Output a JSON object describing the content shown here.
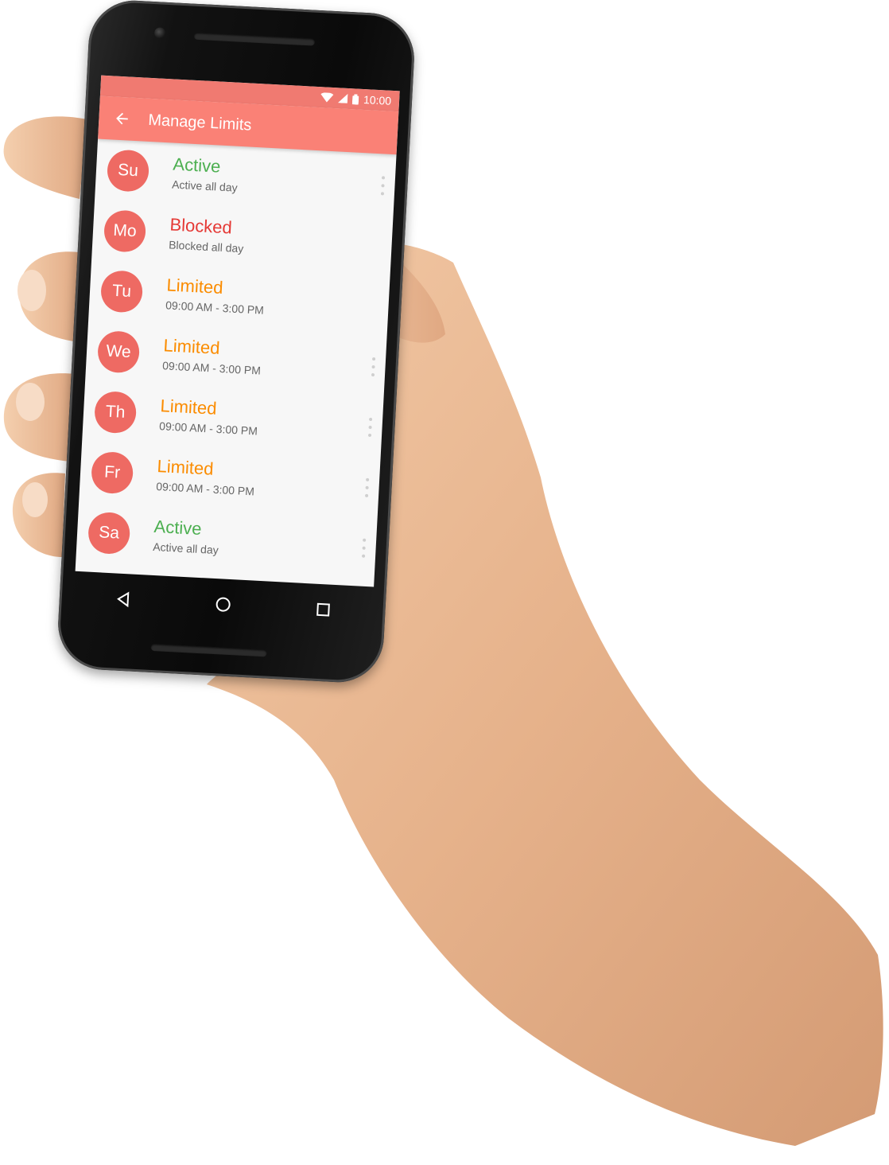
{
  "status_bar": {
    "time": "10:00"
  },
  "app_bar": {
    "title": "Manage Limits"
  },
  "days": [
    {
      "abbr": "Su",
      "status": "Active",
      "detail": "Active all day",
      "state": "active"
    },
    {
      "abbr": "Mo",
      "status": "Blocked",
      "detail": "Blocked all day",
      "state": "blocked"
    },
    {
      "abbr": "Tu",
      "status": "Limited",
      "detail": "09:00 AM - 3:00 PM",
      "state": "limited"
    },
    {
      "abbr": "We",
      "status": "Limited",
      "detail": "09:00 AM - 3:00 PM",
      "state": "limited"
    },
    {
      "abbr": "Th",
      "status": "Limited",
      "detail": "09:00 AM - 3:00 PM",
      "state": "limited"
    },
    {
      "abbr": "Fr",
      "status": "Limited",
      "detail": "09:00 AM - 3:00 PM",
      "state": "limited"
    },
    {
      "abbr": "Sa",
      "status": "Active",
      "detail": "Active all day",
      "state": "active"
    }
  ],
  "colors": {
    "app_bar": "#fa8176",
    "status_bar": "#f07a71",
    "avatar": "#ee6a63",
    "active": "#4caf50",
    "blocked": "#e53935",
    "limited": "#fb8c00"
  },
  "icons": {
    "status_bar": [
      "wifi-icon",
      "signal-icon",
      "battery-icon"
    ],
    "app_bar": "back-arrow-icon",
    "row_action": "more-vert-icon",
    "navigation": [
      "back-triangle-icon",
      "home-circle-icon",
      "recents-square-icon"
    ]
  }
}
